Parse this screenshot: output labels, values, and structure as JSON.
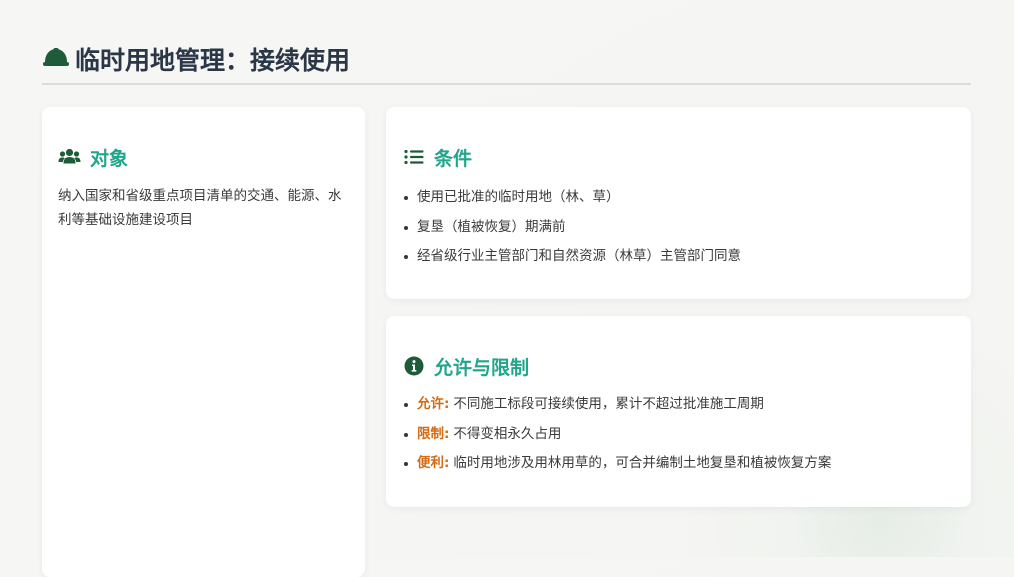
{
  "header": {
    "title": "临时用地管理：接续使用",
    "icon": "hard-hat-icon"
  },
  "colors": {
    "title": "#2b3646",
    "accent": "#21a58b",
    "icon_dark": "#1e5c39",
    "tag": "#d26b12"
  },
  "target": {
    "icon": "users-icon",
    "heading": "对象",
    "text": "纳入国家和省级重点项目清单的交通、能源、水利等基础设施建设项目"
  },
  "conditions": {
    "icon": "list-icon",
    "heading": "条件",
    "items": [
      "使用已批准的临时用地（林、草）",
      "复垦（植被恢复）期满前",
      "经省级行业主管部门和自然资源（林草）主管部门同意"
    ]
  },
  "allow": {
    "icon": "info-circle-icon",
    "heading": "允许与限制",
    "items": [
      {
        "tag": "允许:",
        "text": "不同施工标段可接续使用，累计不超过批准施工周期"
      },
      {
        "tag": "限制:",
        "text": "不得变相永久占用"
      },
      {
        "tag": "便利:",
        "text": "临时用地涉及用林用草的，可合并编制土地复垦和植被恢复方案"
      }
    ]
  }
}
